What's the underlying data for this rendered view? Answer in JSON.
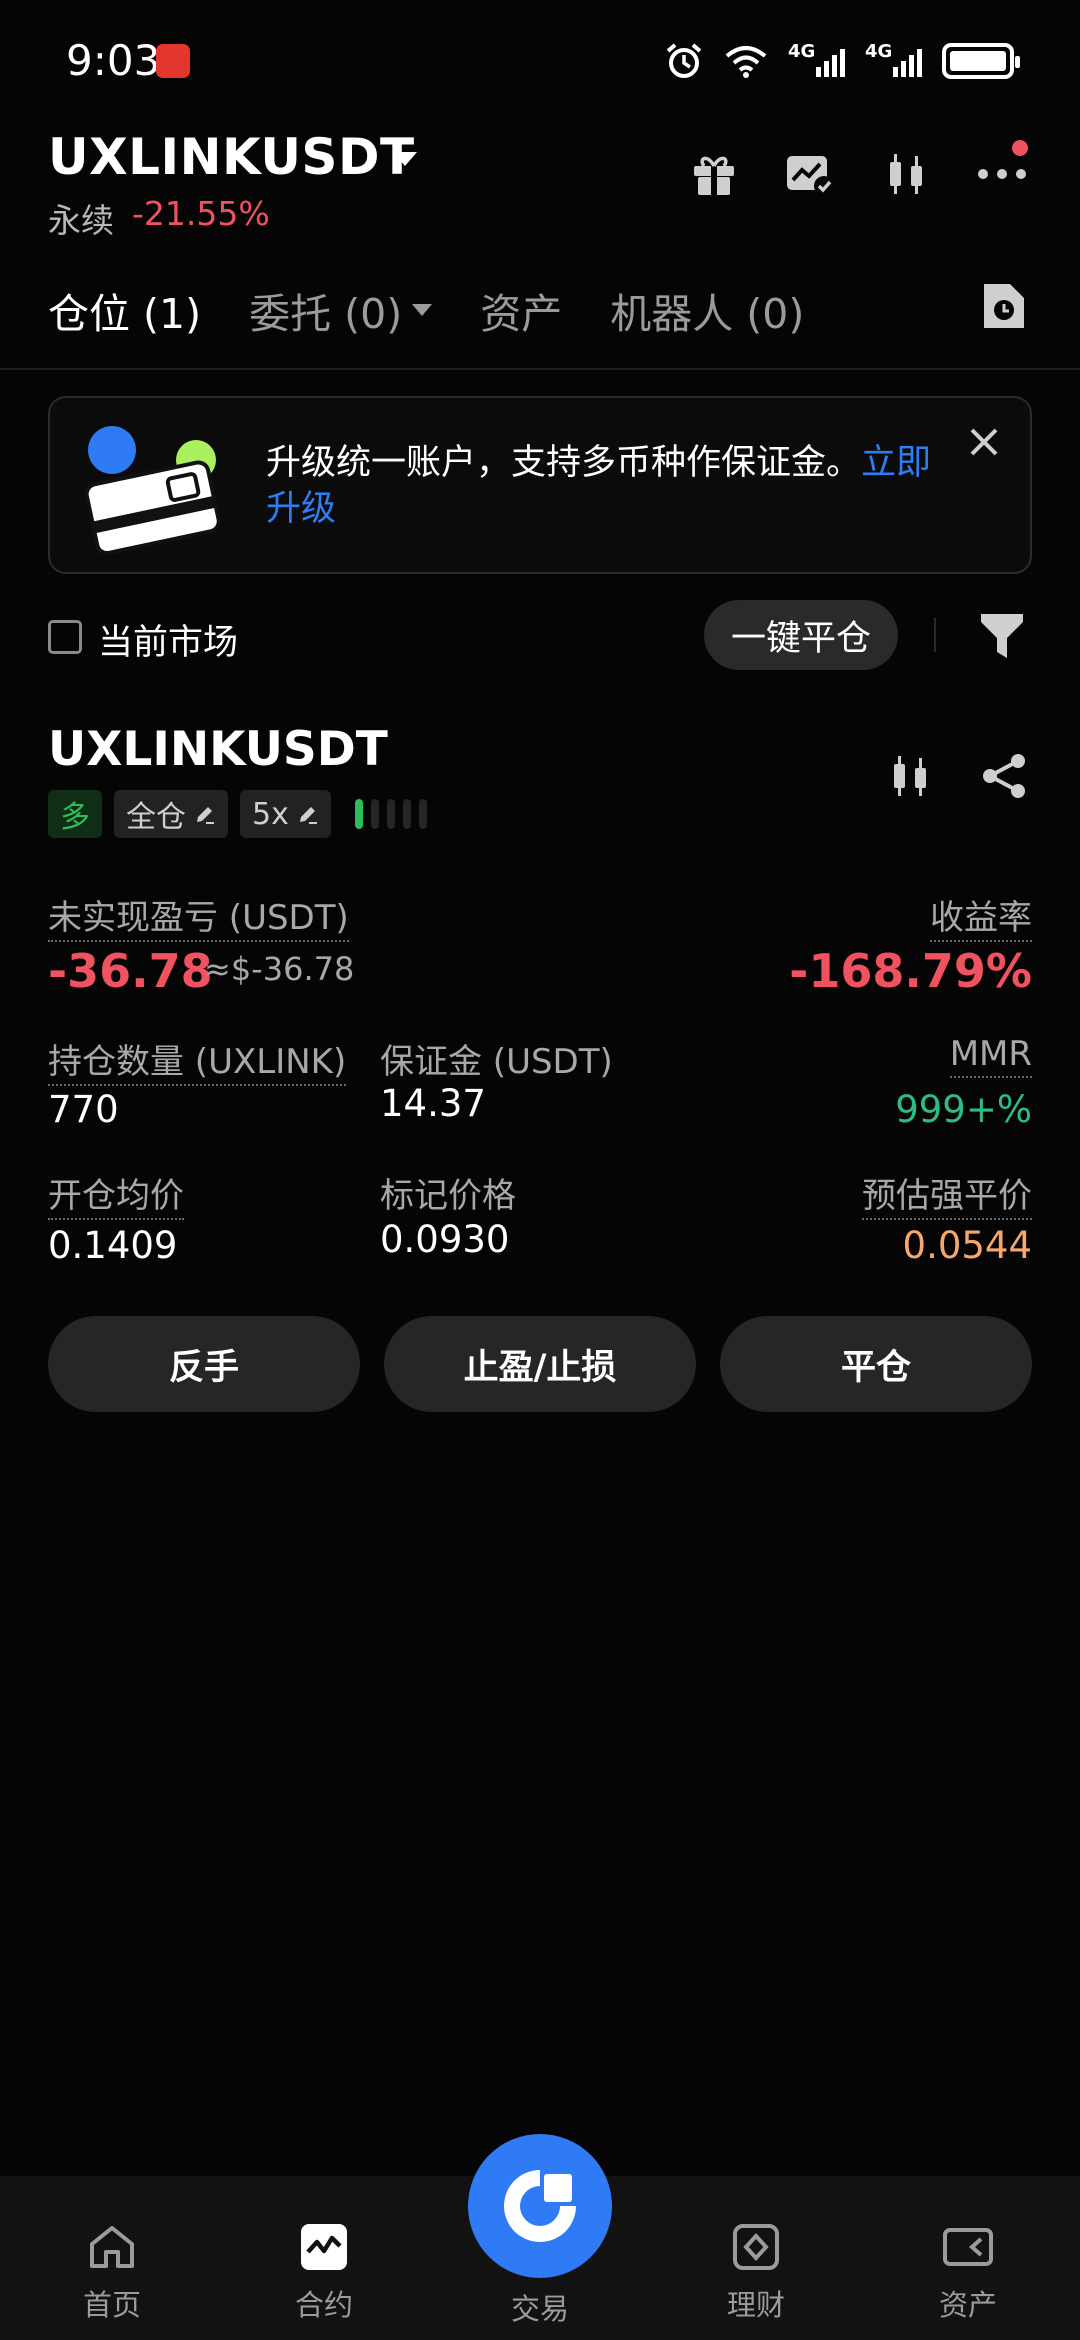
{
  "status_bar": {
    "time": "9:03",
    "net1": "4G",
    "net2": "4G"
  },
  "header": {
    "pair": "UXLINKUSDT",
    "type_label": "永续",
    "change": "-21.55%"
  },
  "tabs": [
    {
      "label": "仓位 (1)"
    },
    {
      "label": "委托 (0)"
    },
    {
      "label": "资产"
    },
    {
      "label": "机器人 (0)"
    }
  ],
  "banner": {
    "text": "升级统一账户，支持多币种作保证金。",
    "link": "立即升级"
  },
  "filter": {
    "current_market_label": "当前市场",
    "close_all_label": "一键平仓"
  },
  "position": {
    "symbol": "UXLINKUSDT",
    "side": "多",
    "margin_mode": "全仓",
    "leverage": "5x",
    "risk_level_of_5": 1,
    "unrealized_pnl_label": "未实现盈亏 (USDT)",
    "unrealized_pnl": "-36.78",
    "unrealized_pnl_usd": "≈$-36.78",
    "roe_label": "收益率",
    "roe": "-168.79%",
    "qty_label": "持仓数量 (UXLINK)",
    "qty": "770",
    "margin_label": "保证金 (USDT)",
    "margin": "14.37",
    "mmr_label": "MMR",
    "mmr": "999+%",
    "entry_label": "开仓均价",
    "entry": "0.1409",
    "mark_label": "标记价格",
    "mark": "0.0930",
    "liq_label": "预估强平价",
    "liq": "0.0544"
  },
  "actions": {
    "reverse": "反手",
    "tpsl": "止盈/止损",
    "close": "平仓"
  },
  "bottom_nav": {
    "home": "首页",
    "contract": "合约",
    "trade": "交易",
    "finance": "理财",
    "assets": "资产"
  },
  "colors": {
    "accent": "#2f7bf5",
    "loss": "#f0535f",
    "gain": "#2dbd84",
    "liq": "#f7a76a"
  }
}
